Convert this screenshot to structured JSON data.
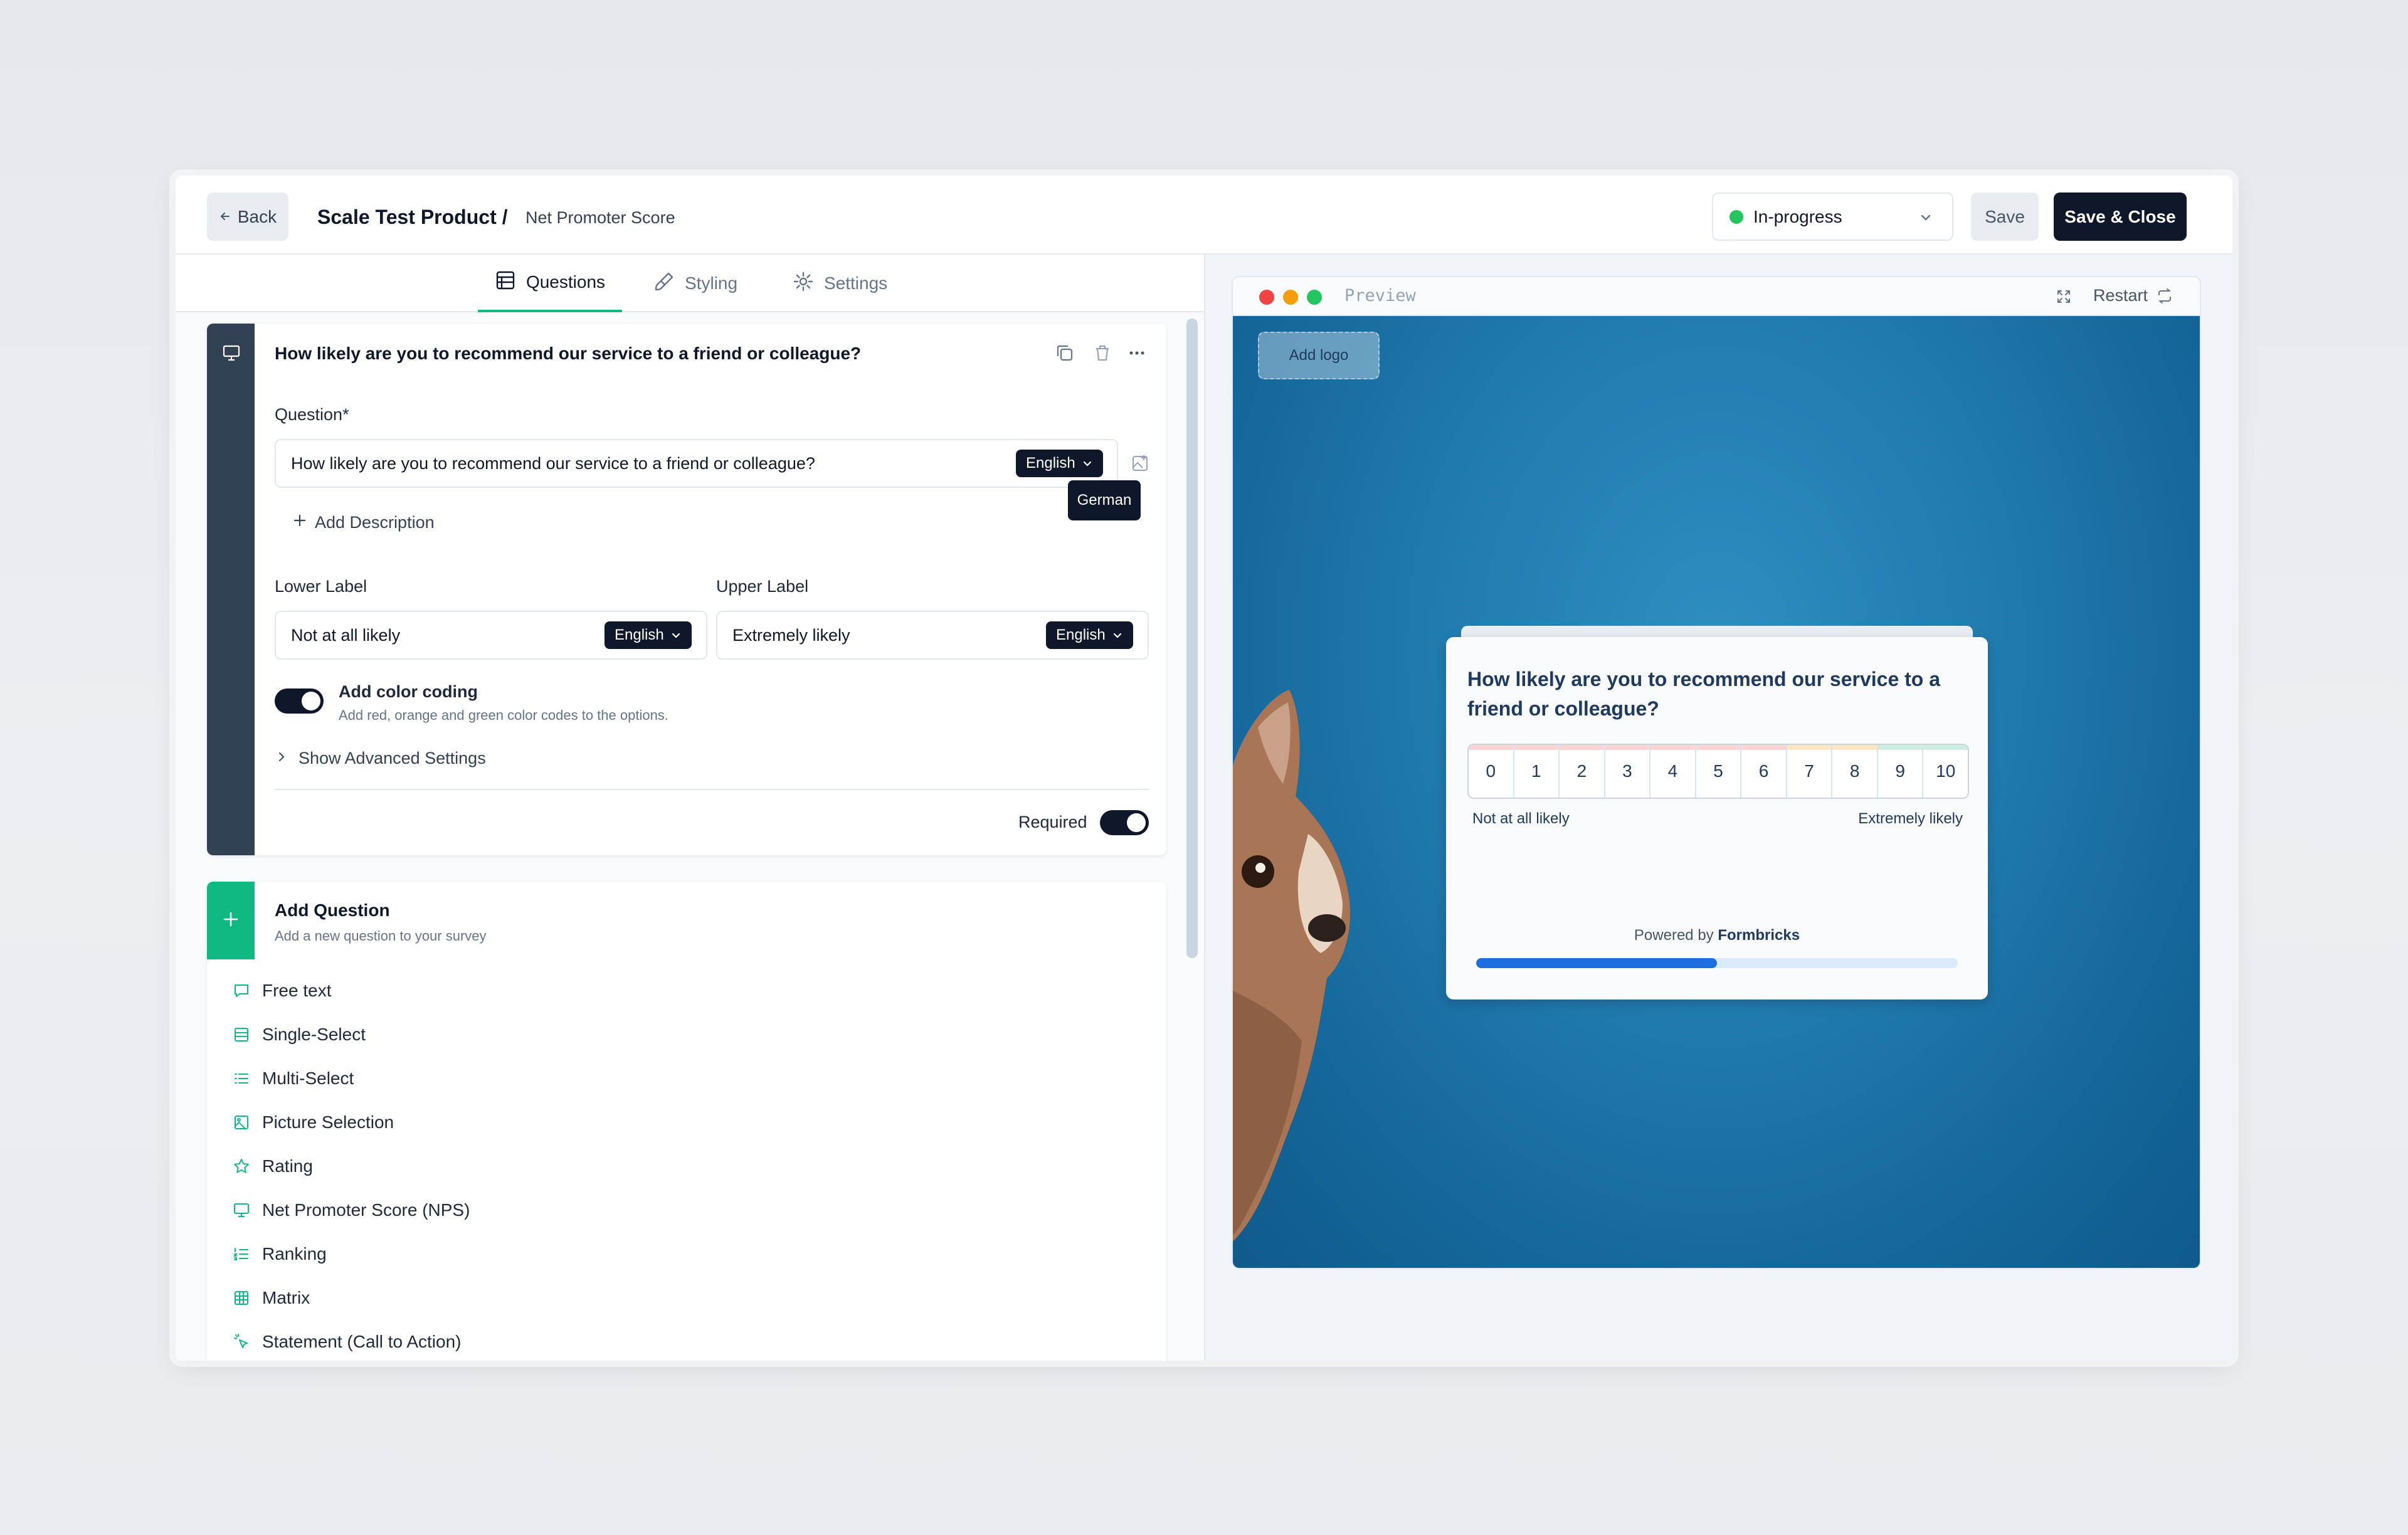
{
  "header": {
    "back_label": "Back",
    "product_title": "Scale Test Product /",
    "survey_name": "Net Promoter Score",
    "status": "In-progress",
    "status_color": "#22c55e",
    "save_label": "Save",
    "save_close_label": "Save & Close"
  },
  "tabs": [
    {
      "label": "Questions",
      "icon": "list-icon",
      "active": true
    },
    {
      "label": "Styling",
      "icon": "paintbrush-icon",
      "active": false
    },
    {
      "label": "Settings",
      "icon": "gear-icon",
      "active": false
    }
  ],
  "question_card": {
    "title": "How likely are you to recommend our service to a friend or colleague?",
    "question_label": "Question*",
    "question_value": "How likely are you to recommend our service to a friend or colleague?",
    "question_lang": "English",
    "tooltip_lang": "German",
    "add_description": "Add Description",
    "lower_label_title": "Lower Label",
    "lower_label_value": "Not at all likely",
    "lower_lang": "English",
    "upper_label_title": "Upper Label",
    "upper_label_value": "Extremely likely",
    "upper_lang": "English",
    "color_coding_title": "Add color coding",
    "color_coding_desc": "Add red, orange and green color codes to the options.",
    "color_coding_on": true,
    "advanced": "Show Advanced Settings",
    "required_label": "Required",
    "required_on": true
  },
  "add_question": {
    "title": "Add Question",
    "subtitle": "Add a new question to your survey",
    "accent": "#10b981",
    "types": [
      {
        "label": "Free text",
        "icon": "message-square-icon"
      },
      {
        "label": "Single-Select",
        "icon": "rows-icon"
      },
      {
        "label": "Multi-Select",
        "icon": "list-icon"
      },
      {
        "label": "Picture Selection",
        "icon": "image-icon"
      },
      {
        "label": "Rating",
        "icon": "star-icon"
      },
      {
        "label": "Net Promoter Score (NPS)",
        "icon": "presentation-icon"
      },
      {
        "label": "Ranking",
        "icon": "list-ordered-icon"
      },
      {
        "label": "Matrix",
        "icon": "grid-icon"
      },
      {
        "label": "Statement (Call to Action)",
        "icon": "mouse-pointer-click-icon"
      }
    ]
  },
  "preview": {
    "title": "Preview",
    "restart_label": "Restart",
    "add_logo": "Add logo",
    "question": "How likely are you to recommend our service to a friend or colleague?",
    "scale": [
      "0",
      "1",
      "2",
      "3",
      "4",
      "5",
      "6",
      "7",
      "8",
      "9",
      "10"
    ],
    "lower_label": "Not at all likely",
    "upper_label": "Extremely likely",
    "powered_prefix": "Powered by",
    "powered_brand": "Formbricks",
    "progress": 0.5
  }
}
